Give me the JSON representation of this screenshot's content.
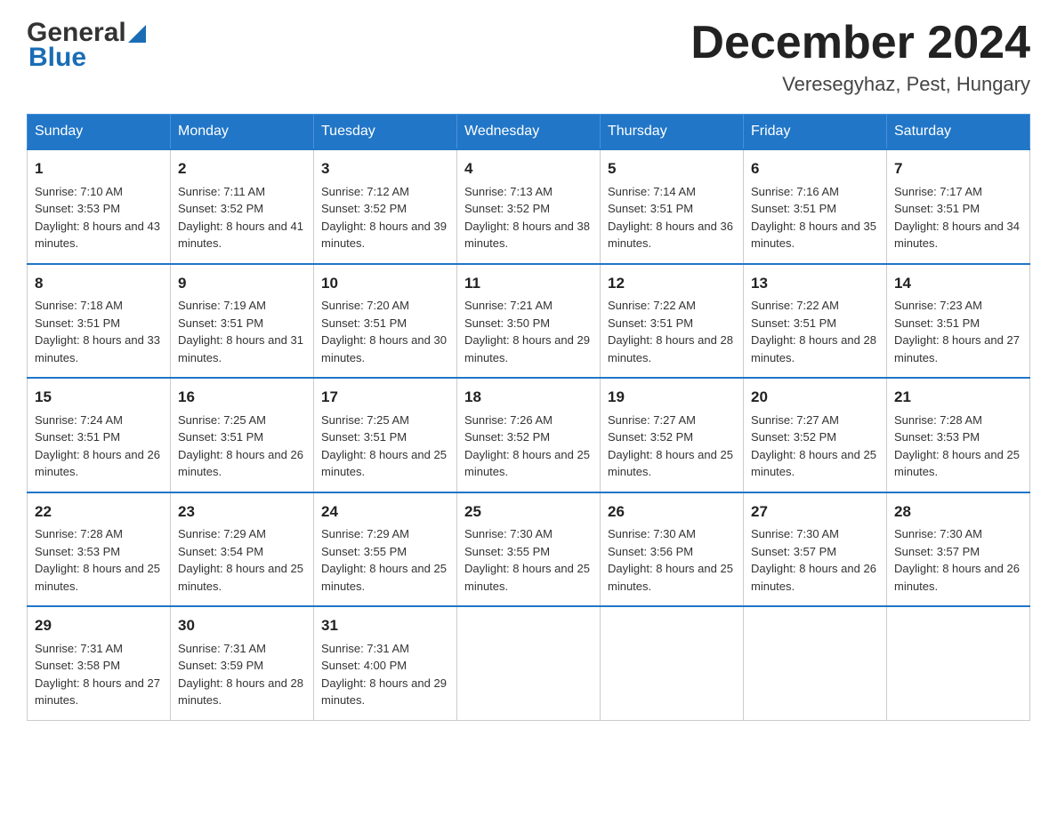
{
  "header": {
    "logo_text_general": "General",
    "logo_text_blue": "Blue",
    "month_title": "December 2024",
    "location": "Veresegyhaz, Pest, Hungary"
  },
  "days_of_week": [
    "Sunday",
    "Monday",
    "Tuesday",
    "Wednesday",
    "Thursday",
    "Friday",
    "Saturday"
  ],
  "weeks": [
    [
      {
        "day": "1",
        "sunrise": "Sunrise: 7:10 AM",
        "sunset": "Sunset: 3:53 PM",
        "daylight": "Daylight: 8 hours and 43 minutes."
      },
      {
        "day": "2",
        "sunrise": "Sunrise: 7:11 AM",
        "sunset": "Sunset: 3:52 PM",
        "daylight": "Daylight: 8 hours and 41 minutes."
      },
      {
        "day": "3",
        "sunrise": "Sunrise: 7:12 AM",
        "sunset": "Sunset: 3:52 PM",
        "daylight": "Daylight: 8 hours and 39 minutes."
      },
      {
        "day": "4",
        "sunrise": "Sunrise: 7:13 AM",
        "sunset": "Sunset: 3:52 PM",
        "daylight": "Daylight: 8 hours and 38 minutes."
      },
      {
        "day": "5",
        "sunrise": "Sunrise: 7:14 AM",
        "sunset": "Sunset: 3:51 PM",
        "daylight": "Daylight: 8 hours and 36 minutes."
      },
      {
        "day": "6",
        "sunrise": "Sunrise: 7:16 AM",
        "sunset": "Sunset: 3:51 PM",
        "daylight": "Daylight: 8 hours and 35 minutes."
      },
      {
        "day": "7",
        "sunrise": "Sunrise: 7:17 AM",
        "sunset": "Sunset: 3:51 PM",
        "daylight": "Daylight: 8 hours and 34 minutes."
      }
    ],
    [
      {
        "day": "8",
        "sunrise": "Sunrise: 7:18 AM",
        "sunset": "Sunset: 3:51 PM",
        "daylight": "Daylight: 8 hours and 33 minutes."
      },
      {
        "day": "9",
        "sunrise": "Sunrise: 7:19 AM",
        "sunset": "Sunset: 3:51 PM",
        "daylight": "Daylight: 8 hours and 31 minutes."
      },
      {
        "day": "10",
        "sunrise": "Sunrise: 7:20 AM",
        "sunset": "Sunset: 3:51 PM",
        "daylight": "Daylight: 8 hours and 30 minutes."
      },
      {
        "day": "11",
        "sunrise": "Sunrise: 7:21 AM",
        "sunset": "Sunset: 3:50 PM",
        "daylight": "Daylight: 8 hours and 29 minutes."
      },
      {
        "day": "12",
        "sunrise": "Sunrise: 7:22 AM",
        "sunset": "Sunset: 3:51 PM",
        "daylight": "Daylight: 8 hours and 28 minutes."
      },
      {
        "day": "13",
        "sunrise": "Sunrise: 7:22 AM",
        "sunset": "Sunset: 3:51 PM",
        "daylight": "Daylight: 8 hours and 28 minutes."
      },
      {
        "day": "14",
        "sunrise": "Sunrise: 7:23 AM",
        "sunset": "Sunset: 3:51 PM",
        "daylight": "Daylight: 8 hours and 27 minutes."
      }
    ],
    [
      {
        "day": "15",
        "sunrise": "Sunrise: 7:24 AM",
        "sunset": "Sunset: 3:51 PM",
        "daylight": "Daylight: 8 hours and 26 minutes."
      },
      {
        "day": "16",
        "sunrise": "Sunrise: 7:25 AM",
        "sunset": "Sunset: 3:51 PM",
        "daylight": "Daylight: 8 hours and 26 minutes."
      },
      {
        "day": "17",
        "sunrise": "Sunrise: 7:25 AM",
        "sunset": "Sunset: 3:51 PM",
        "daylight": "Daylight: 8 hours and 25 minutes."
      },
      {
        "day": "18",
        "sunrise": "Sunrise: 7:26 AM",
        "sunset": "Sunset: 3:52 PM",
        "daylight": "Daylight: 8 hours and 25 minutes."
      },
      {
        "day": "19",
        "sunrise": "Sunrise: 7:27 AM",
        "sunset": "Sunset: 3:52 PM",
        "daylight": "Daylight: 8 hours and 25 minutes."
      },
      {
        "day": "20",
        "sunrise": "Sunrise: 7:27 AM",
        "sunset": "Sunset: 3:52 PM",
        "daylight": "Daylight: 8 hours and 25 minutes."
      },
      {
        "day": "21",
        "sunrise": "Sunrise: 7:28 AM",
        "sunset": "Sunset: 3:53 PM",
        "daylight": "Daylight: 8 hours and 25 minutes."
      }
    ],
    [
      {
        "day": "22",
        "sunrise": "Sunrise: 7:28 AM",
        "sunset": "Sunset: 3:53 PM",
        "daylight": "Daylight: 8 hours and 25 minutes."
      },
      {
        "day": "23",
        "sunrise": "Sunrise: 7:29 AM",
        "sunset": "Sunset: 3:54 PM",
        "daylight": "Daylight: 8 hours and 25 minutes."
      },
      {
        "day": "24",
        "sunrise": "Sunrise: 7:29 AM",
        "sunset": "Sunset: 3:55 PM",
        "daylight": "Daylight: 8 hours and 25 minutes."
      },
      {
        "day": "25",
        "sunrise": "Sunrise: 7:30 AM",
        "sunset": "Sunset: 3:55 PM",
        "daylight": "Daylight: 8 hours and 25 minutes."
      },
      {
        "day": "26",
        "sunrise": "Sunrise: 7:30 AM",
        "sunset": "Sunset: 3:56 PM",
        "daylight": "Daylight: 8 hours and 25 minutes."
      },
      {
        "day": "27",
        "sunrise": "Sunrise: 7:30 AM",
        "sunset": "Sunset: 3:57 PM",
        "daylight": "Daylight: 8 hours and 26 minutes."
      },
      {
        "day": "28",
        "sunrise": "Sunrise: 7:30 AM",
        "sunset": "Sunset: 3:57 PM",
        "daylight": "Daylight: 8 hours and 26 minutes."
      }
    ],
    [
      {
        "day": "29",
        "sunrise": "Sunrise: 7:31 AM",
        "sunset": "Sunset: 3:58 PM",
        "daylight": "Daylight: 8 hours and 27 minutes."
      },
      {
        "day": "30",
        "sunrise": "Sunrise: 7:31 AM",
        "sunset": "Sunset: 3:59 PM",
        "daylight": "Daylight: 8 hours and 28 minutes."
      },
      {
        "day": "31",
        "sunrise": "Sunrise: 7:31 AM",
        "sunset": "Sunset: 4:00 PM",
        "daylight": "Daylight: 8 hours and 29 minutes."
      },
      null,
      null,
      null,
      null
    ]
  ]
}
